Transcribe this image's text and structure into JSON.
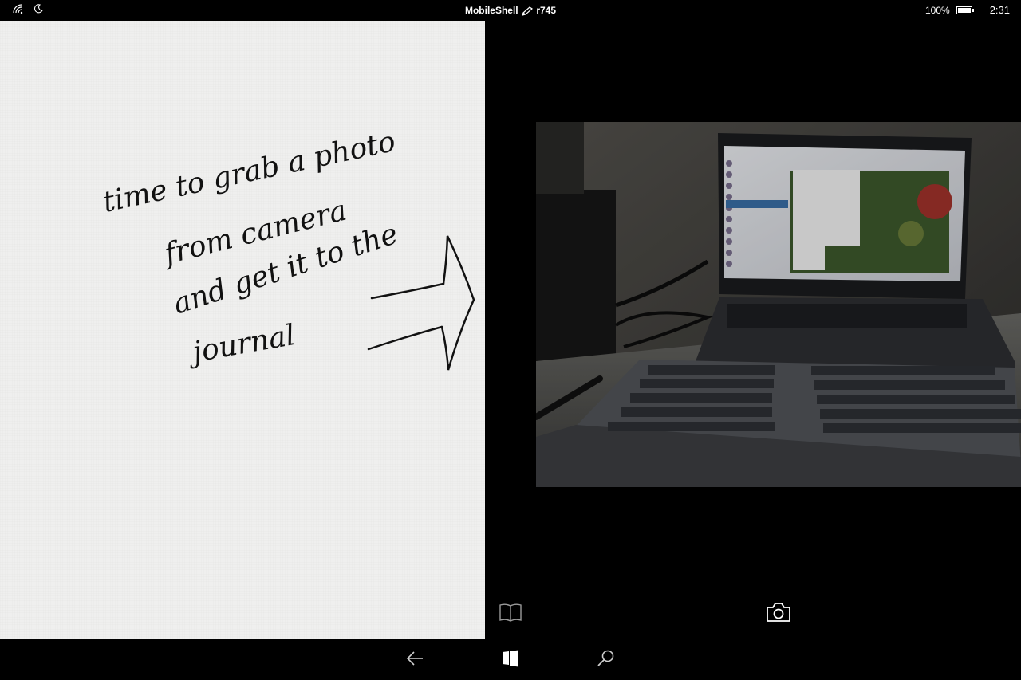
{
  "status_bar": {
    "app_name": "MobileShell",
    "build": "r745",
    "battery_percent": "100%",
    "time": "2:31",
    "icons": [
      "wifi-icon",
      "quiet-hours-moon-icon",
      "pen-icon",
      "battery-icon"
    ]
  },
  "journal": {
    "handwritten_lines": [
      "time to grab a photo",
      "from camera",
      "and get it to the",
      "journal"
    ]
  },
  "toolbar": {
    "journal_icon": "book-icon",
    "capture_icon": "camera-icon"
  },
  "nav_bar": {
    "icons": [
      "back-arrow-icon",
      "windows-start-icon",
      "search-icon"
    ]
  },
  "colors": {
    "background": "#000000",
    "paper": "#efefee",
    "ink": "#111111",
    "foreground": "#ffffff"
  }
}
